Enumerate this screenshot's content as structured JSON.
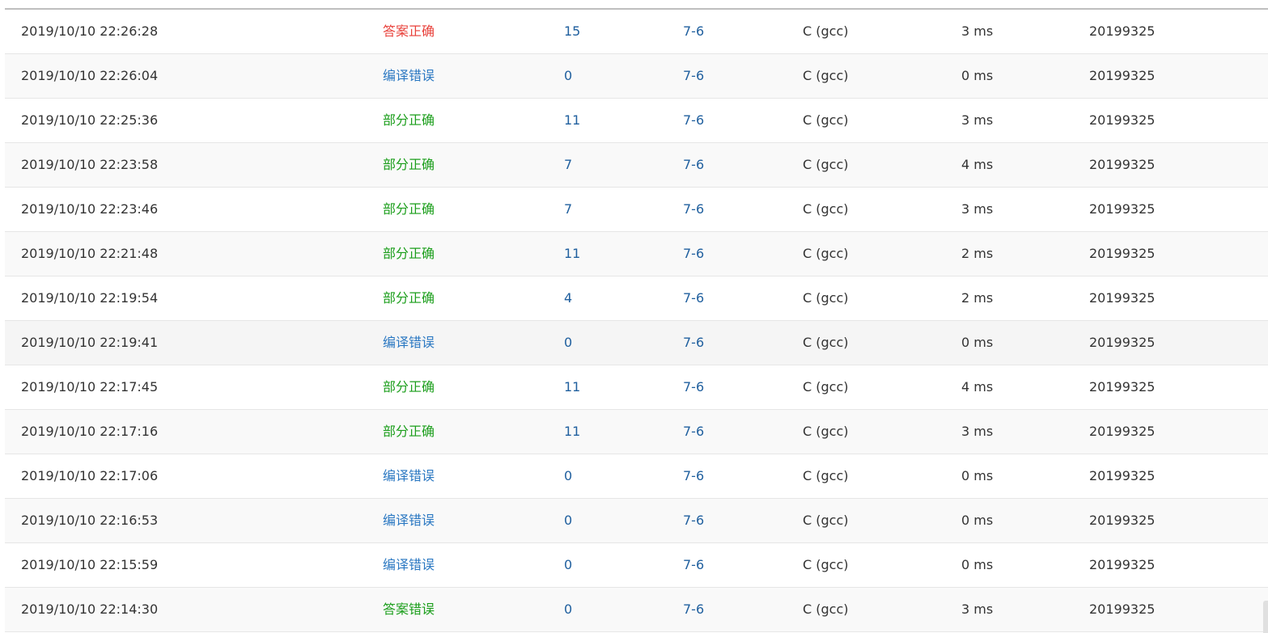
{
  "colors": {
    "status_accepted": "#e8403a",
    "status_compile_error": "#2b78c2",
    "status_partial": "#1b9e1b",
    "status_wrong_answer": "#1b9e1b",
    "link": "#1f5f9e"
  },
  "submissions": [
    {
      "time": "2019/10/10 22:26:28",
      "status": "答案正确",
      "status_type": "accepted",
      "score": "15",
      "problem": "7-6",
      "compiler": "C (gcc)",
      "runtime": "3 ms",
      "user": "20199325"
    },
    {
      "time": "2019/10/10 22:26:04",
      "status": "编译错误",
      "status_type": "compile",
      "score": "0",
      "problem": "7-6",
      "compiler": "C (gcc)",
      "runtime": "0 ms",
      "user": "20199325"
    },
    {
      "time": "2019/10/10 22:25:36",
      "status": "部分正确",
      "status_type": "partial",
      "score": "11",
      "problem": "7-6",
      "compiler": "C (gcc)",
      "runtime": "3 ms",
      "user": "20199325"
    },
    {
      "time": "2019/10/10 22:23:58",
      "status": "部分正确",
      "status_type": "partial",
      "score": "7",
      "problem": "7-6",
      "compiler": "C (gcc)",
      "runtime": "4 ms",
      "user": "20199325"
    },
    {
      "time": "2019/10/10 22:23:46",
      "status": "部分正确",
      "status_type": "partial",
      "score": "7",
      "problem": "7-6",
      "compiler": "C (gcc)",
      "runtime": "3 ms",
      "user": "20199325"
    },
    {
      "time": "2019/10/10 22:21:48",
      "status": "部分正确",
      "status_type": "partial",
      "score": "11",
      "problem": "7-6",
      "compiler": "C (gcc)",
      "runtime": "2 ms",
      "user": "20199325"
    },
    {
      "time": "2019/10/10 22:19:54",
      "status": "部分正确",
      "status_type": "partial",
      "score": "4",
      "problem": "7-6",
      "compiler": "C (gcc)",
      "runtime": "2 ms",
      "user": "20199325"
    },
    {
      "time": "2019/10/10 22:19:41",
      "status": "编译错误",
      "status_type": "compile",
      "score": "0",
      "problem": "7-6",
      "compiler": "C (gcc)",
      "runtime": "0 ms",
      "user": "20199325"
    },
    {
      "time": "2019/10/10 22:17:45",
      "status": "部分正确",
      "status_type": "partial",
      "score": "11",
      "problem": "7-6",
      "compiler": "C (gcc)",
      "runtime": "4 ms",
      "user": "20199325"
    },
    {
      "time": "2019/10/10 22:17:16",
      "status": "部分正确",
      "status_type": "partial",
      "score": "11",
      "problem": "7-6",
      "compiler": "C (gcc)",
      "runtime": "3 ms",
      "user": "20199325"
    },
    {
      "time": "2019/10/10 22:17:06",
      "status": "编译错误",
      "status_type": "compile",
      "score": "0",
      "problem": "7-6",
      "compiler": "C (gcc)",
      "runtime": "0 ms",
      "user": "20199325"
    },
    {
      "time": "2019/10/10 22:16:53",
      "status": "编译错误",
      "status_type": "compile",
      "score": "0",
      "problem": "7-6",
      "compiler": "C (gcc)",
      "runtime": "0 ms",
      "user": "20199325"
    },
    {
      "time": "2019/10/10 22:15:59",
      "status": "编译错误",
      "status_type": "compile",
      "score": "0",
      "problem": "7-6",
      "compiler": "C (gcc)",
      "runtime": "0 ms",
      "user": "20199325"
    },
    {
      "time": "2019/10/10 22:14:30",
      "status": "答案错误",
      "status_type": "wrong",
      "score": "0",
      "problem": "7-6",
      "compiler": "C (gcc)",
      "runtime": "3 ms",
      "user": "20199325"
    }
  ]
}
